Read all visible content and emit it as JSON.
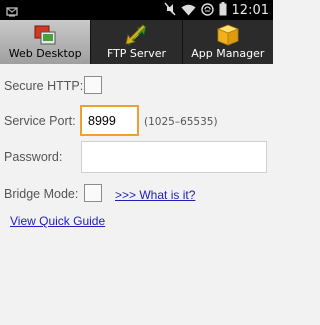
{
  "status_bar": {
    "time": "12:01",
    "icons": [
      "notification-icon",
      "mute-icon",
      "wifi-icon",
      "sync-icon",
      "battery-icon"
    ]
  },
  "tabs": [
    {
      "label": "Web Desktop",
      "icon": "web-desktop-icon",
      "active": true
    },
    {
      "label": "FTP Server",
      "icon": "ftp-arrows-icon",
      "active": false
    },
    {
      "label": "App Manager",
      "icon": "package-box-icon",
      "active": false
    }
  ],
  "form": {
    "secure_http_label": "Secure HTTP:",
    "secure_http_checked": false,
    "service_port_label": "Service Port:",
    "service_port_value": "8999",
    "service_port_hint": "(1025–65535)",
    "password_label": "Password:",
    "password_value": "",
    "bridge_mode_label": "Bridge Mode:",
    "bridge_mode_checked": false,
    "what_is_it_link": ">>> What is it?",
    "quick_guide_link": "View Quick Guide"
  },
  "colors": {
    "accent_focus": "#f0a030",
    "link": "#2020c0",
    "background": "#f2f2f2"
  }
}
